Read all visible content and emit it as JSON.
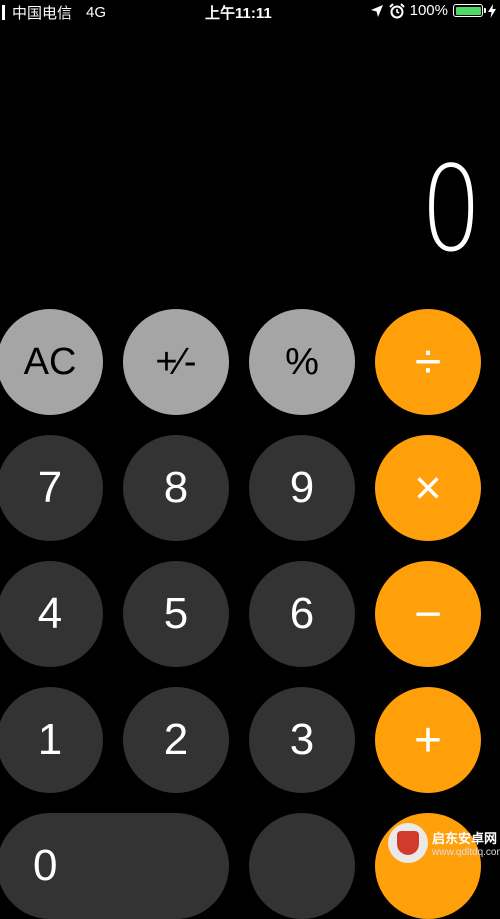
{
  "status_bar": {
    "carrier": "中国电信",
    "network": "4G",
    "time": "上午11:11",
    "battery_percent": "100%",
    "battery_level": 1.0,
    "icons": [
      "location-arrow-icon",
      "alarm-clock-icon",
      "battery-icon",
      "charging-bolt-icon"
    ]
  },
  "display": {
    "value": "0"
  },
  "keys": {
    "ac": "AC",
    "plus_minus": "+∕-",
    "percent": "%",
    "divide": "÷",
    "seven": "7",
    "eight": "8",
    "nine": "9",
    "multiply": "×",
    "four": "4",
    "five": "5",
    "six": "6",
    "minus": "−",
    "one": "1",
    "two": "2",
    "three": "3",
    "plus": "+",
    "zero": "0"
  },
  "colors": {
    "background": "#000000",
    "function_key": "#a5a5a5",
    "digit_key": "#333333",
    "operator_key": "#ff9f0a",
    "battery": "#4cd964"
  },
  "watermark": {
    "name": "启东安卓网",
    "url": "www.qdltdq.com"
  }
}
